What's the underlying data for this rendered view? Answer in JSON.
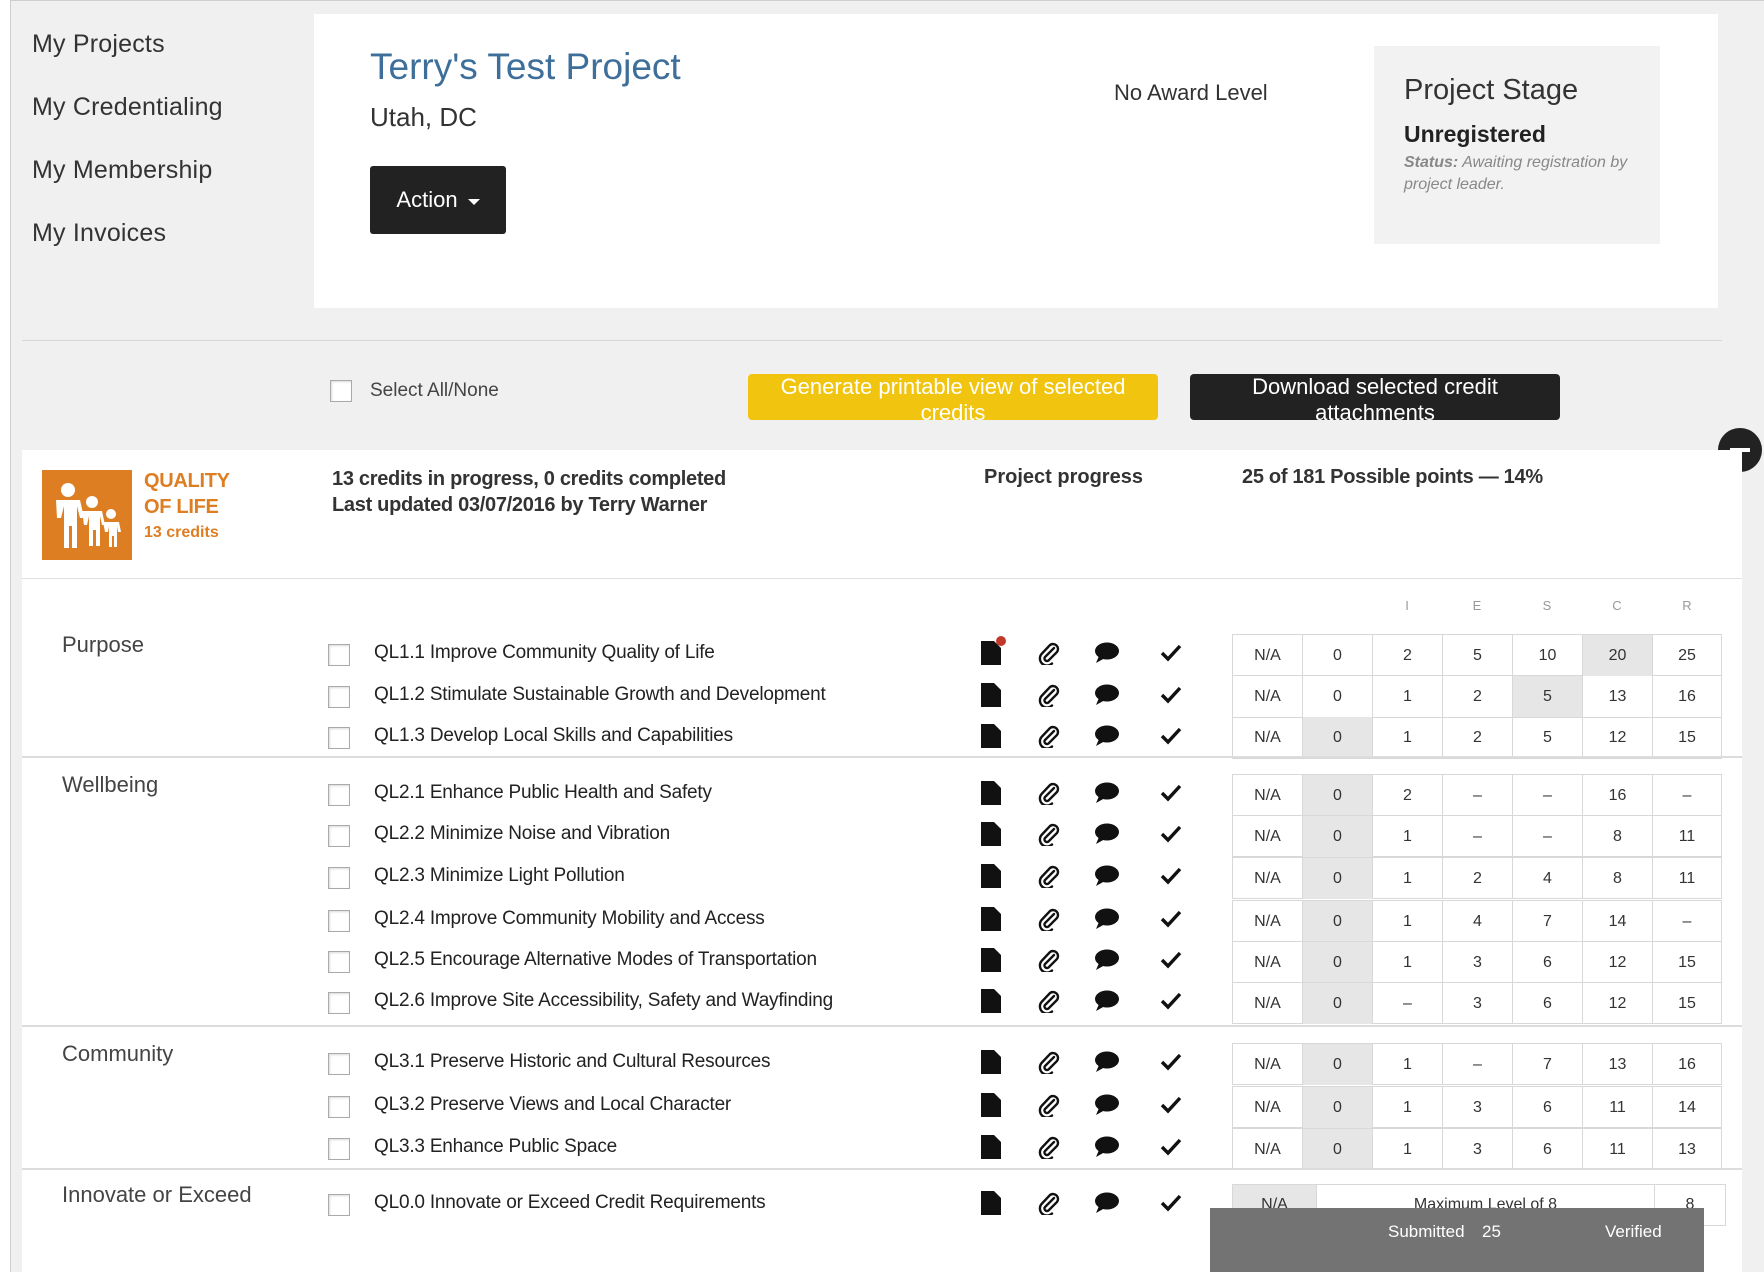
{
  "sidebar": {
    "items": [
      {
        "label": "My Projects"
      },
      {
        "label": "My Credentialing"
      },
      {
        "label": "My Membership"
      },
      {
        "label": "My Invoices"
      }
    ]
  },
  "project": {
    "title": "Terry's Test Project",
    "location": "Utah, DC",
    "action_label": "Action",
    "award_level": "No Award Level",
    "stage": {
      "title": "Project Stage",
      "value": "Unregistered",
      "status_label": "Status:",
      "status_text": "Awaiting registration by project leader."
    }
  },
  "toolbar": {
    "select_all_label": "Select All/None",
    "printable_label": "Generate printable view of selected credits",
    "download_label": "Download selected credit attachments"
  },
  "category": {
    "name_line1": "QUALITY",
    "name_line2": "OF LIFE",
    "count": "13 credits",
    "progress_line1": "13 credits in progress, 0 credits completed",
    "progress_line2": "Last updated 03/07/2016 by Terry Warner",
    "progress_label": "Project progress",
    "points_label": "25 of 181 Possible points — 14%",
    "level_headers": [
      "I",
      "E",
      "S",
      "C",
      "R"
    ]
  },
  "groups": [
    {
      "name": "Purpose",
      "credits": [
        {
          "name": "QL1.1 Improve Community Quality of Life",
          "levels": [
            "N/A",
            "0",
            "2",
            "5",
            "10",
            "20",
            "25"
          ],
          "selected": 5
        },
        {
          "name": "QL1.2 Stimulate Sustainable Growth and Development",
          "levels": [
            "N/A",
            "0",
            "1",
            "2",
            "5",
            "13",
            "16"
          ],
          "selected": 4
        },
        {
          "name": "QL1.3 Develop Local Skills and Capabilities",
          "levels": [
            "N/A",
            "0",
            "1",
            "2",
            "5",
            "12",
            "15"
          ],
          "selected": 1
        }
      ]
    },
    {
      "name": "Wellbeing",
      "credits": [
        {
          "name": "QL2.1 Enhance Public Health and Safety",
          "levels": [
            "N/A",
            "0",
            "2",
            "–",
            "–",
            "16",
            "–"
          ],
          "selected": 1
        },
        {
          "name": "QL2.2 Minimize Noise and Vibration",
          "levels": [
            "N/A",
            "0",
            "1",
            "–",
            "–",
            "8",
            "11"
          ],
          "selected": 1
        },
        {
          "name": "QL2.3 Minimize Light Pollution",
          "levels": [
            "N/A",
            "0",
            "1",
            "2",
            "4",
            "8",
            "11"
          ],
          "selected": 1
        },
        {
          "name": "QL2.4 Improve Community Mobility and Access",
          "levels": [
            "N/A",
            "0",
            "1",
            "4",
            "7",
            "14",
            "–"
          ],
          "selected": 1
        },
        {
          "name": "QL2.5 Encourage Alternative Modes of Transportation",
          "levels": [
            "N/A",
            "0",
            "1",
            "3",
            "6",
            "12",
            "15"
          ],
          "selected": 1
        },
        {
          "name": "QL2.6 Improve Site Accessibility, Safety and Wayfinding",
          "levels": [
            "N/A",
            "0",
            "–",
            "3",
            "6",
            "12",
            "15"
          ],
          "selected": 1
        }
      ]
    },
    {
      "name": "Community",
      "credits": [
        {
          "name": "QL3.1 Preserve Historic and Cultural Resources",
          "levels": [
            "N/A",
            "0",
            "1",
            "–",
            "7",
            "13",
            "16"
          ],
          "selected": 1
        },
        {
          "name": "QL3.2 Preserve Views and Local Character",
          "levels": [
            "N/A",
            "0",
            "1",
            "3",
            "6",
            "11",
            "14"
          ],
          "selected": 1
        },
        {
          "name": "QL3.3 Enhance Public Space",
          "levels": [
            "N/A",
            "0",
            "1",
            "3",
            "6",
            "11",
            "13"
          ],
          "selected": 1
        }
      ]
    },
    {
      "name": "Innovate or Exceed",
      "credits": [
        {
          "name": "QL0.0 Innovate or Exceed Credit Requirements",
          "na": "N/A",
          "max_label": "Maximum Level of 8",
          "max_value": "8"
        }
      ]
    }
  ],
  "summary": {
    "submitted_label": "Submitted",
    "submitted_value": "25",
    "verified_label": "Verified"
  }
}
